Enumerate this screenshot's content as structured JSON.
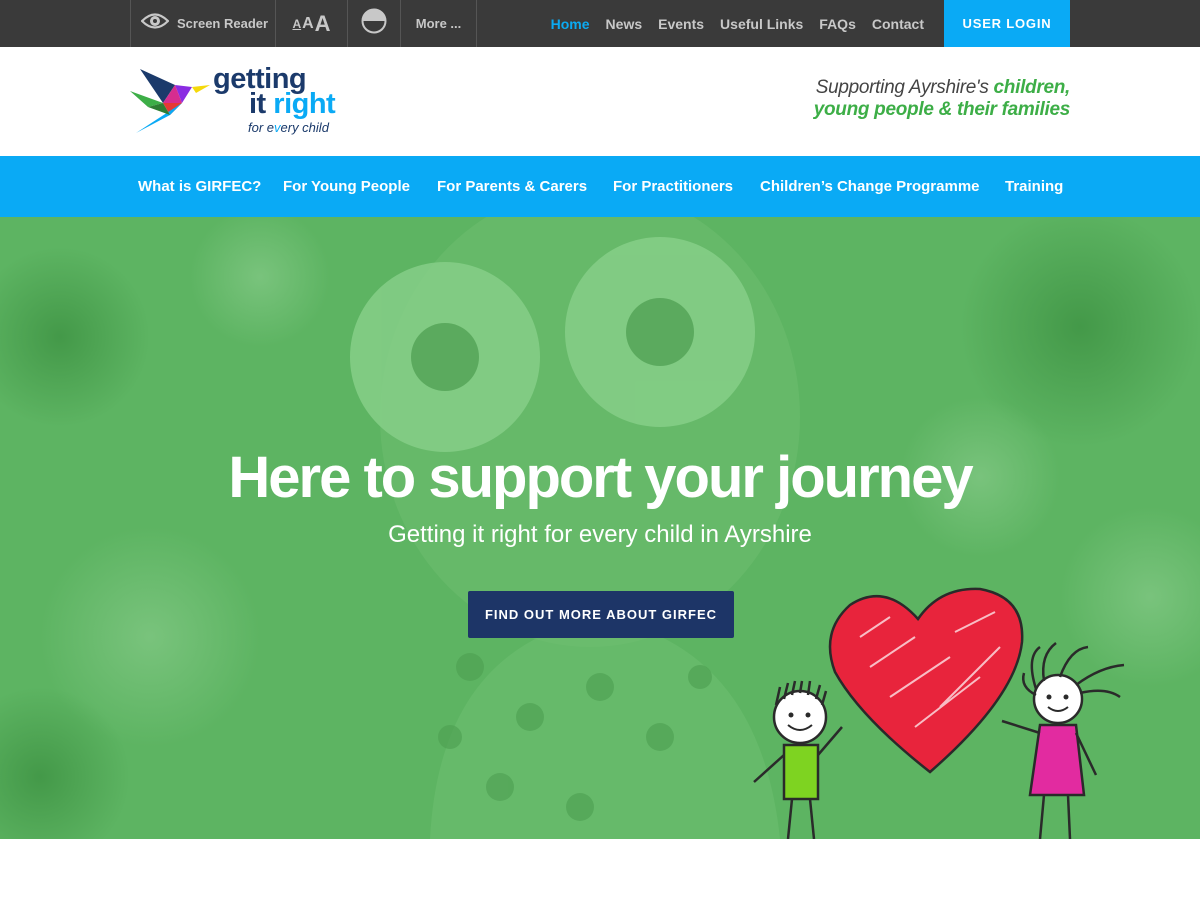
{
  "utility": {
    "screen_reader_label": "Screen Reader",
    "text_size_letters": [
      "A",
      "A",
      "A"
    ],
    "more_label": "More ..."
  },
  "topnav": {
    "items": [
      "Home",
      "News",
      "Events",
      "Useful Links",
      "FAQs",
      "Contact"
    ],
    "active_item": "Home",
    "login_label": "USER LOGIN"
  },
  "logo": {
    "line1": "getting",
    "line2_a": "it",
    "line2_b": "right",
    "line3_a": "for e",
    "line3_b": "v",
    "line3_c": "ery child"
  },
  "tagline": {
    "part1": "Supporting Ayrshire's",
    "part2": "children,",
    "part3": "young people & their families"
  },
  "mainnav": {
    "items": [
      "What is GIRFEC?",
      "For Young People",
      "For Parents & Carers",
      "For Practitioners",
      "Children’s Change Programme",
      "Training"
    ]
  },
  "hero": {
    "title": "Here to support your journey",
    "subtitle": "Getting it right for every child in Ayrshire",
    "cta_label": "FIND OUT MORE ABOUT GIRFEC"
  },
  "colors": {
    "topbar_bg": "#3a3a3a",
    "accent_blue": "#0aaaf5",
    "brand_navy": "#1b3a6b",
    "brand_green": "#3dae47",
    "hero_overlay_green": "#5bb360",
    "cta_bg": "#1d3567"
  },
  "icons": [
    "eye-icon",
    "text-size-icon",
    "contrast-icon",
    "logo-bird-icon",
    "heart-illustration",
    "boy-illustration",
    "girl-illustration"
  ]
}
